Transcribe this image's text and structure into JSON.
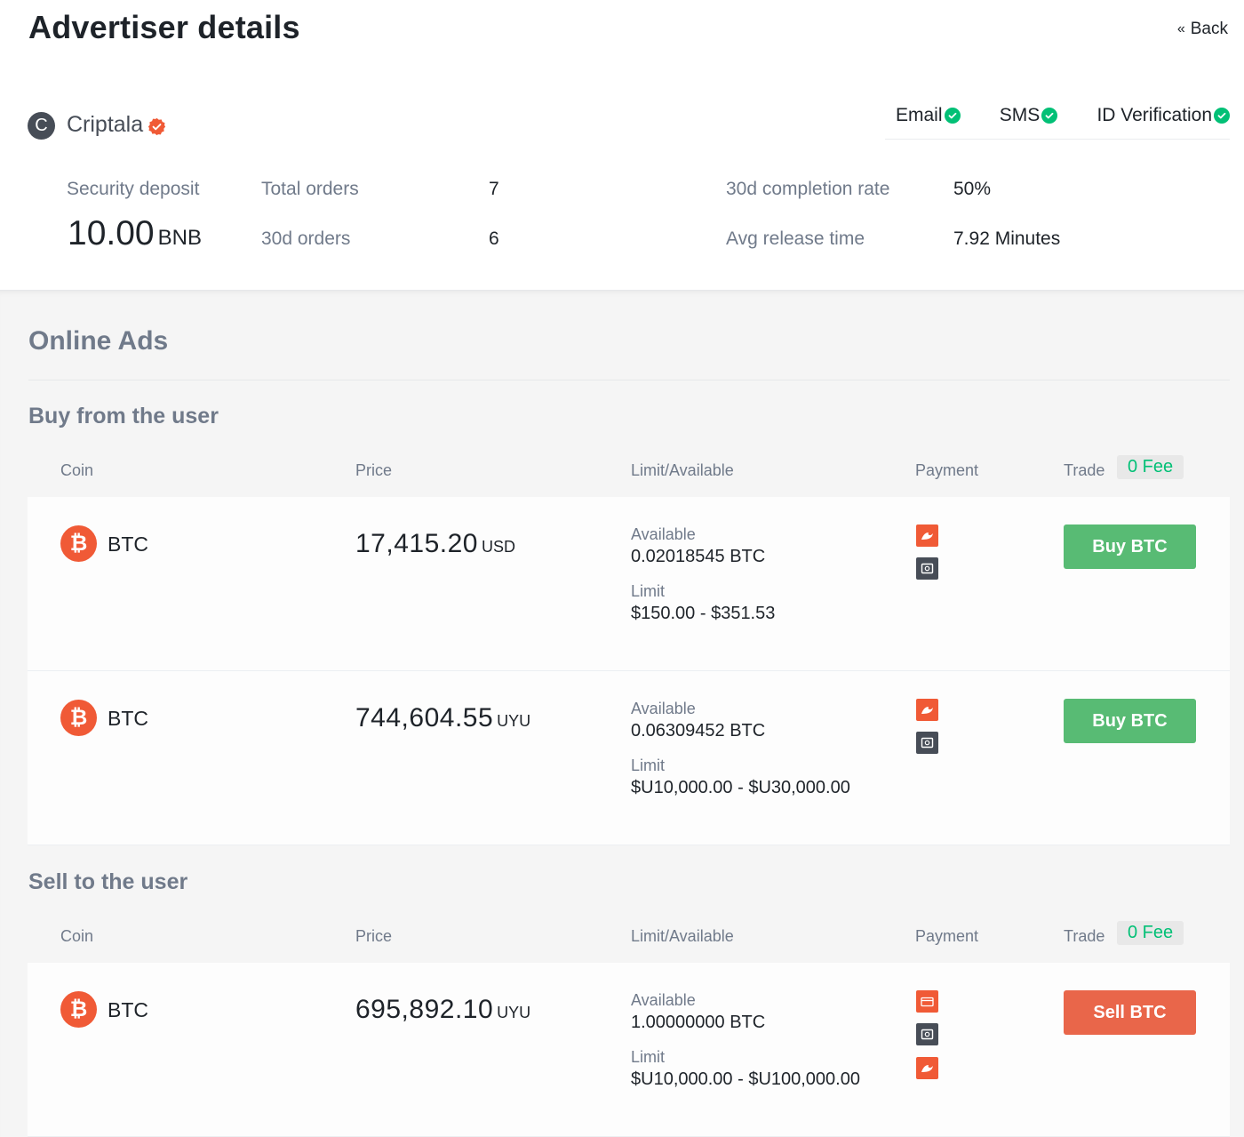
{
  "header": {
    "title": "Advertiser details",
    "back_label": "Back"
  },
  "advertiser": {
    "initial": "C",
    "name": "Criptala"
  },
  "verifications": [
    {
      "label": "Email"
    },
    {
      "label": "SMS"
    },
    {
      "label": "ID Verification"
    }
  ],
  "stats": {
    "deposit_label": "Security deposit",
    "deposit_value": "10.00",
    "deposit_unit": "BNB",
    "total_orders_label": "Total orders",
    "total_orders_value": "7",
    "orders_30d_label": "30d orders",
    "orders_30d_value": "6",
    "completion_label": "30d completion rate",
    "completion_value": "50%",
    "release_label": "Avg release time",
    "release_value": "7.92 Minutes"
  },
  "online_ads_title": "Online Ads",
  "table_headers": {
    "coin": "Coin",
    "price": "Price",
    "limit": "Limit/Available",
    "payment": "Payment",
    "trade": "Trade",
    "fee": "0 Fee"
  },
  "buy_section": {
    "title": "Buy from the user",
    "rows": [
      {
        "coin": "BTC",
        "price": "17,415.20",
        "currency": "USD",
        "available_label": "Available",
        "available": "0.02018545 BTC",
        "limit_label": "Limit",
        "limit": "$150.00 - $351.53",
        "button": "Buy BTC"
      },
      {
        "coin": "BTC",
        "price": "744,604.55",
        "currency": "UYU",
        "available_label": "Available",
        "available": "0.06309452 BTC",
        "limit_label": "Limit",
        "limit": "$U10,000.00 - $U30,000.00",
        "button": "Buy BTC"
      }
    ]
  },
  "sell_section": {
    "title": "Sell to the user",
    "rows": [
      {
        "coin": "BTC",
        "price": "695,892.10",
        "currency": "UYU",
        "available_label": "Available",
        "available": "1.00000000 BTC",
        "limit_label": "Limit",
        "limit": "$U10,000.00 - $U100,000.00",
        "button": "Sell BTC"
      }
    ]
  },
  "colors": {
    "buy": "#58bb74",
    "sell": "#e9664a",
    "accent_orange": "#f05a36",
    "success_green": "#02c076"
  }
}
